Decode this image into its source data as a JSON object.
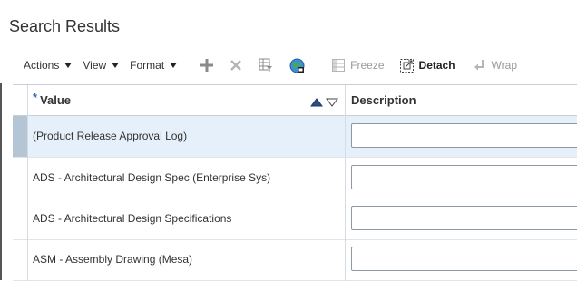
{
  "page": {
    "title": "Search Results"
  },
  "toolbar": {
    "menus": [
      {
        "label": "Actions"
      },
      {
        "label": "View"
      },
      {
        "label": "Format"
      }
    ],
    "freeze_label": "Freeze",
    "detach_label": "Detach",
    "wrap_label": "Wrap",
    "icons": [
      "add-icon",
      "delete-icon",
      "query-by-example-icon",
      "globe-icon",
      "freeze-icon",
      "detach-icon",
      "wrap-icon"
    ]
  },
  "table": {
    "columns": {
      "value": {
        "label": "Value",
        "required_marker": "*"
      },
      "description": {
        "label": "Description"
      }
    },
    "rows": [
      {
        "value": "(Product Release Approval Log)",
        "description": ""
      },
      {
        "value": "ADS - Architectural Design Spec (Enterprise Sys)",
        "description": ""
      },
      {
        "value": "ADS - Architectural Design Specifications",
        "description": ""
      },
      {
        "value": "ASM - Assembly Drawing (Mesa)",
        "description": ""
      }
    ],
    "selected_row": 0
  },
  "colors": {
    "selected_row_bg": "#e6f0fa",
    "selected_row_header": "#b4c6d6",
    "border": "#c9cfd6",
    "required_star": "#3a6fb0"
  }
}
